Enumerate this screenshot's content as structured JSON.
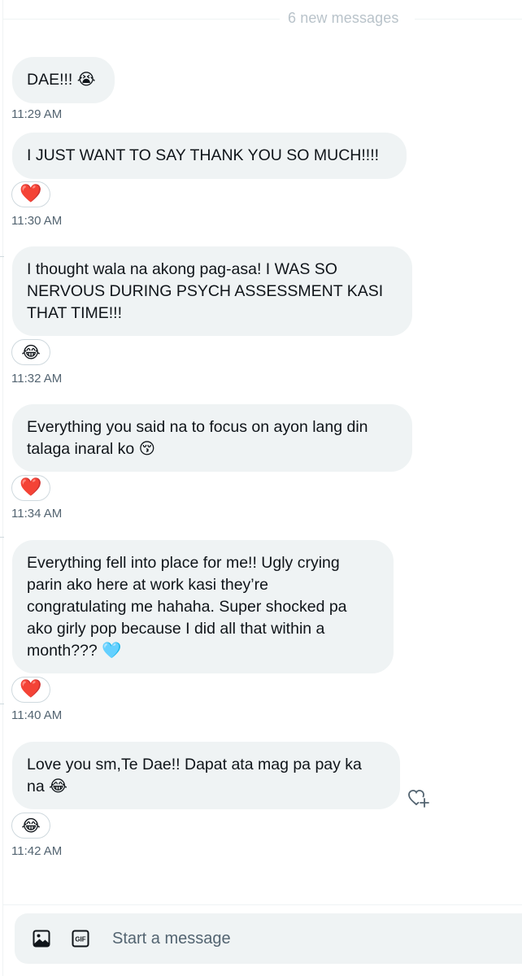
{
  "divider": {
    "label": "6 new messages"
  },
  "messages": [
    {
      "lines": [
        "DAE!!! 😭"
      ],
      "time": "11:29 AM",
      "reaction": null
    },
    {
      "lines": [
        "I JUST WANT TO SAY THANK YOU SO MUCH!!!!"
      ],
      "time": "11:30 AM",
      "reaction": "❤️"
    },
    {
      "lines": [
        "I thought wala na akong pag-asa! I WAS SO",
        "NERVOUS DURING PSYCH ASSESSMENT KASI",
        "THAT TIME!!!"
      ],
      "time": "11:32 AM",
      "reaction": "😂"
    },
    {
      "lines": [
        "Everything you said na to focus on ayon lang din",
        "talaga inaral ko 😚"
      ],
      "time": "11:34 AM",
      "reaction": "❤️"
    },
    {
      "lines": [
        "Everything fell into place for me!! Ugly crying",
        "parin ako here at work kasi they’re",
        "congratulating me hahaha. Super shocked pa",
        "ako girly pop because I did all that within a",
        "month??? 🩵"
      ],
      "time": "11:40 AM",
      "reaction": "❤️"
    },
    {
      "lines": [
        "Love you sm,Te Dae!! Dapat ata mag pa pay ka",
        "na 😂"
      ],
      "time": "11:42 AM",
      "reaction": "😂"
    }
  ],
  "composer": {
    "placeholder": "Start a message"
  },
  "icons": {
    "media": "image-icon",
    "gif": "gif-icon",
    "add_reaction": "heart-plus-icon",
    "gif_label": "GIF"
  },
  "colors": {
    "bubble_bg": "#eff3f4",
    "text": "#0f1419",
    "timestamp": "#536471",
    "divider_text": "#b9c3ca",
    "heart": "#e0245e"
  }
}
